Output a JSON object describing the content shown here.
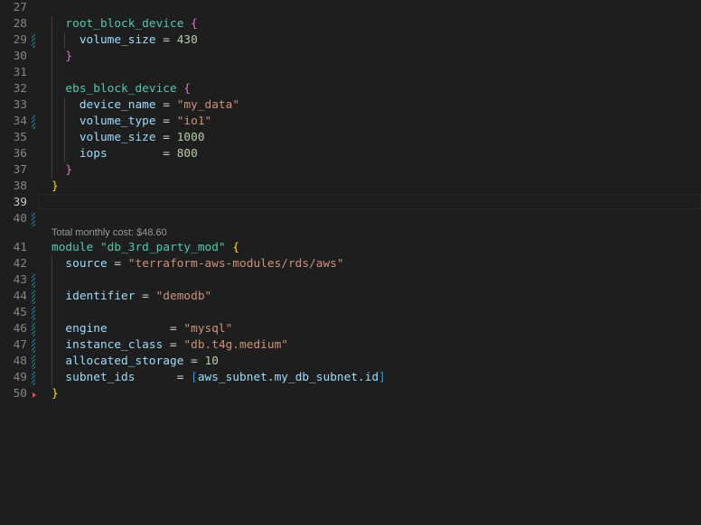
{
  "editor": {
    "codelens": "Total monthly cost: $48.60",
    "lines": [
      {
        "num": "27",
        "indent": "",
        "tokens": []
      },
      {
        "num": "28",
        "indent": "  ",
        "tokens": [
          {
            "t": "root_block_device",
            "c": "k"
          },
          {
            "t": " ",
            "c": "p"
          },
          {
            "t": "{",
            "c": "b2"
          }
        ]
      },
      {
        "num": "29",
        "indent": "    ",
        "mark": true,
        "tokens": [
          {
            "t": "volume_size",
            "c": "a"
          },
          {
            "t": " = ",
            "c": "p"
          },
          {
            "t": "430",
            "c": "n"
          }
        ]
      },
      {
        "num": "30",
        "indent": "  ",
        "tokens": [
          {
            "t": "}",
            "c": "b2"
          }
        ]
      },
      {
        "num": "31",
        "indent": "",
        "tokens": []
      },
      {
        "num": "32",
        "indent": "  ",
        "tokens": [
          {
            "t": "ebs_block_device",
            "c": "k"
          },
          {
            "t": " ",
            "c": "p"
          },
          {
            "t": "{",
            "c": "b2"
          }
        ]
      },
      {
        "num": "33",
        "indent": "    ",
        "tokens": [
          {
            "t": "device_name",
            "c": "a"
          },
          {
            "t": " = ",
            "c": "p"
          },
          {
            "t": "\"my_data\"",
            "c": "s"
          }
        ]
      },
      {
        "num": "34",
        "indent": "    ",
        "mark": true,
        "tokens": [
          {
            "t": "volume_type",
            "c": "a"
          },
          {
            "t": " = ",
            "c": "p"
          },
          {
            "t": "\"io1\"",
            "c": "s"
          }
        ]
      },
      {
        "num": "35",
        "indent": "    ",
        "tokens": [
          {
            "t": "volume_size",
            "c": "a"
          },
          {
            "t": " = ",
            "c": "p"
          },
          {
            "t": "1000",
            "c": "n"
          }
        ]
      },
      {
        "num": "36",
        "indent": "    ",
        "tokens": [
          {
            "t": "iops",
            "c": "a"
          },
          {
            "t": "        = ",
            "c": "p"
          },
          {
            "t": "800",
            "c": "n"
          }
        ]
      },
      {
        "num": "37",
        "indent": "  ",
        "tokens": [
          {
            "t": "}",
            "c": "b2"
          }
        ]
      },
      {
        "num": "38",
        "indent": "",
        "tokens": [
          {
            "t": "}",
            "c": "b1"
          }
        ]
      },
      {
        "num": "39",
        "indent": "",
        "active": true,
        "tokens": []
      },
      {
        "num": "40",
        "indent": "",
        "mark": true,
        "tokens": []
      },
      {
        "num": "41",
        "indent": "",
        "tokens": [
          {
            "t": "module",
            "c": "k"
          },
          {
            "t": " ",
            "c": "p"
          },
          {
            "t": "\"db_3rd_party_mod\"",
            "c": "k"
          },
          {
            "t": " ",
            "c": "p"
          },
          {
            "t": "{",
            "c": "b1"
          }
        ]
      },
      {
        "num": "42",
        "indent": "  ",
        "tokens": [
          {
            "t": "source",
            "c": "a"
          },
          {
            "t": " = ",
            "c": "p"
          },
          {
            "t": "\"terraform-aws-modules/rds/aws\"",
            "c": "s"
          }
        ]
      },
      {
        "num": "43",
        "indent": "",
        "mark": true,
        "tokens": []
      },
      {
        "num": "44",
        "indent": "  ",
        "mark": true,
        "tokens": [
          {
            "t": "identifier",
            "c": "a"
          },
          {
            "t": " = ",
            "c": "p"
          },
          {
            "t": "\"demodb\"",
            "c": "s"
          }
        ]
      },
      {
        "num": "45",
        "indent": "",
        "mark": true,
        "tokens": []
      },
      {
        "num": "46",
        "indent": "  ",
        "mark": true,
        "tokens": [
          {
            "t": "engine",
            "c": "a"
          },
          {
            "t": "         = ",
            "c": "p"
          },
          {
            "t": "\"mysql\"",
            "c": "s"
          }
        ]
      },
      {
        "num": "47",
        "indent": "  ",
        "mark": true,
        "tokens": [
          {
            "t": "instance_class",
            "c": "a"
          },
          {
            "t": " = ",
            "c": "p"
          },
          {
            "t": "\"db.t4g.medium\"",
            "c": "s"
          }
        ]
      },
      {
        "num": "48",
        "indent": "  ",
        "mark": true,
        "tokens": [
          {
            "t": "allocated_storage",
            "c": "a"
          },
          {
            "t": " = ",
            "c": "p"
          },
          {
            "t": "10",
            "c": "n"
          }
        ]
      },
      {
        "num": "49",
        "indent": "  ",
        "mark": true,
        "tokens": [
          {
            "t": "subnet_ids",
            "c": "a"
          },
          {
            "t": "      = ",
            "c": "p"
          },
          {
            "t": "[",
            "c": "b3"
          },
          {
            "t": "aws_subnet.my_db_subnet.id",
            "c": "a"
          },
          {
            "t": "]",
            "c": "b3"
          }
        ]
      },
      {
        "num": "50",
        "indent": "",
        "fold": true,
        "tokens": [
          {
            "t": "}",
            "c": "b1"
          }
        ]
      }
    ]
  }
}
